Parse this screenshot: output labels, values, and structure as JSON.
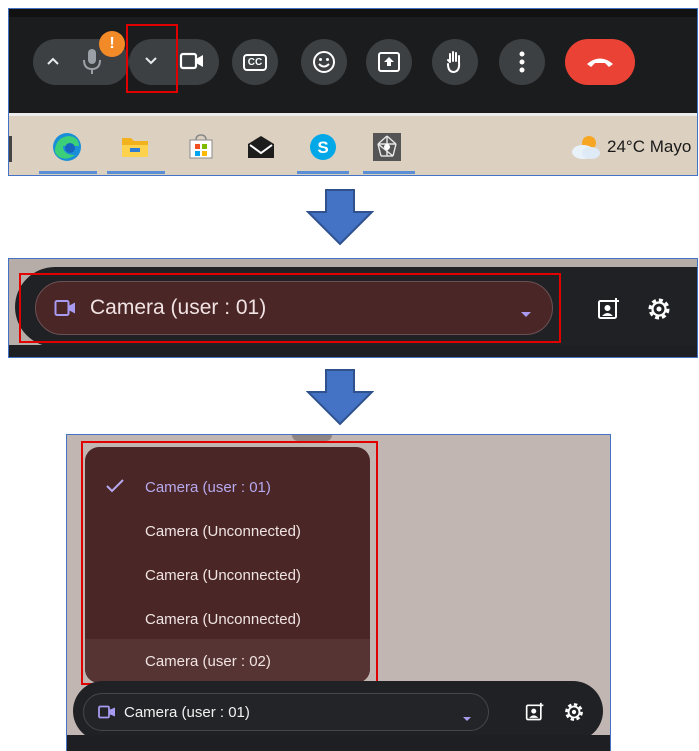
{
  "colors": {
    "toolbar_bg": "#1b1c1e",
    "button_bg": "#3c4043",
    "hangup": "#ea4335",
    "warning": "#f28b27",
    "highlight_box": "#e00000",
    "menu_bg": "#4a2627",
    "selected_text": "#b7a9ee",
    "accent_purple": "#a89af0"
  },
  "toolbar": {
    "warning_badge": "!",
    "buttons": [
      "chevron-up-icon",
      "microphone-icon",
      "chevron-down-icon",
      "camera-icon",
      "captions-icon",
      "emoji-icon",
      "present-icon",
      "raise-hand-icon",
      "more-options-icon",
      "hang-up-icon"
    ],
    "captions_label": "CC"
  },
  "taskbar": {
    "apps": [
      "edge-icon",
      "file-explorer-icon",
      "microsoft-store-icon",
      "mail-icon",
      "skype-icon",
      "network-app-icon"
    ],
    "weather_text": "24°C  Mayo"
  },
  "camera_selector": {
    "selected_label": "Camera (user : 01)"
  },
  "camera_menu": {
    "items": [
      {
        "label": "Camera (user : 01)",
        "selected": true
      },
      {
        "label": "Camera (Unconnected)",
        "selected": false
      },
      {
        "label": "Camera (Unconnected)",
        "selected": false
      },
      {
        "label": "Camera (Unconnected)",
        "selected": false
      },
      {
        "label": "Camera (user : 02)",
        "selected": false
      }
    ]
  }
}
